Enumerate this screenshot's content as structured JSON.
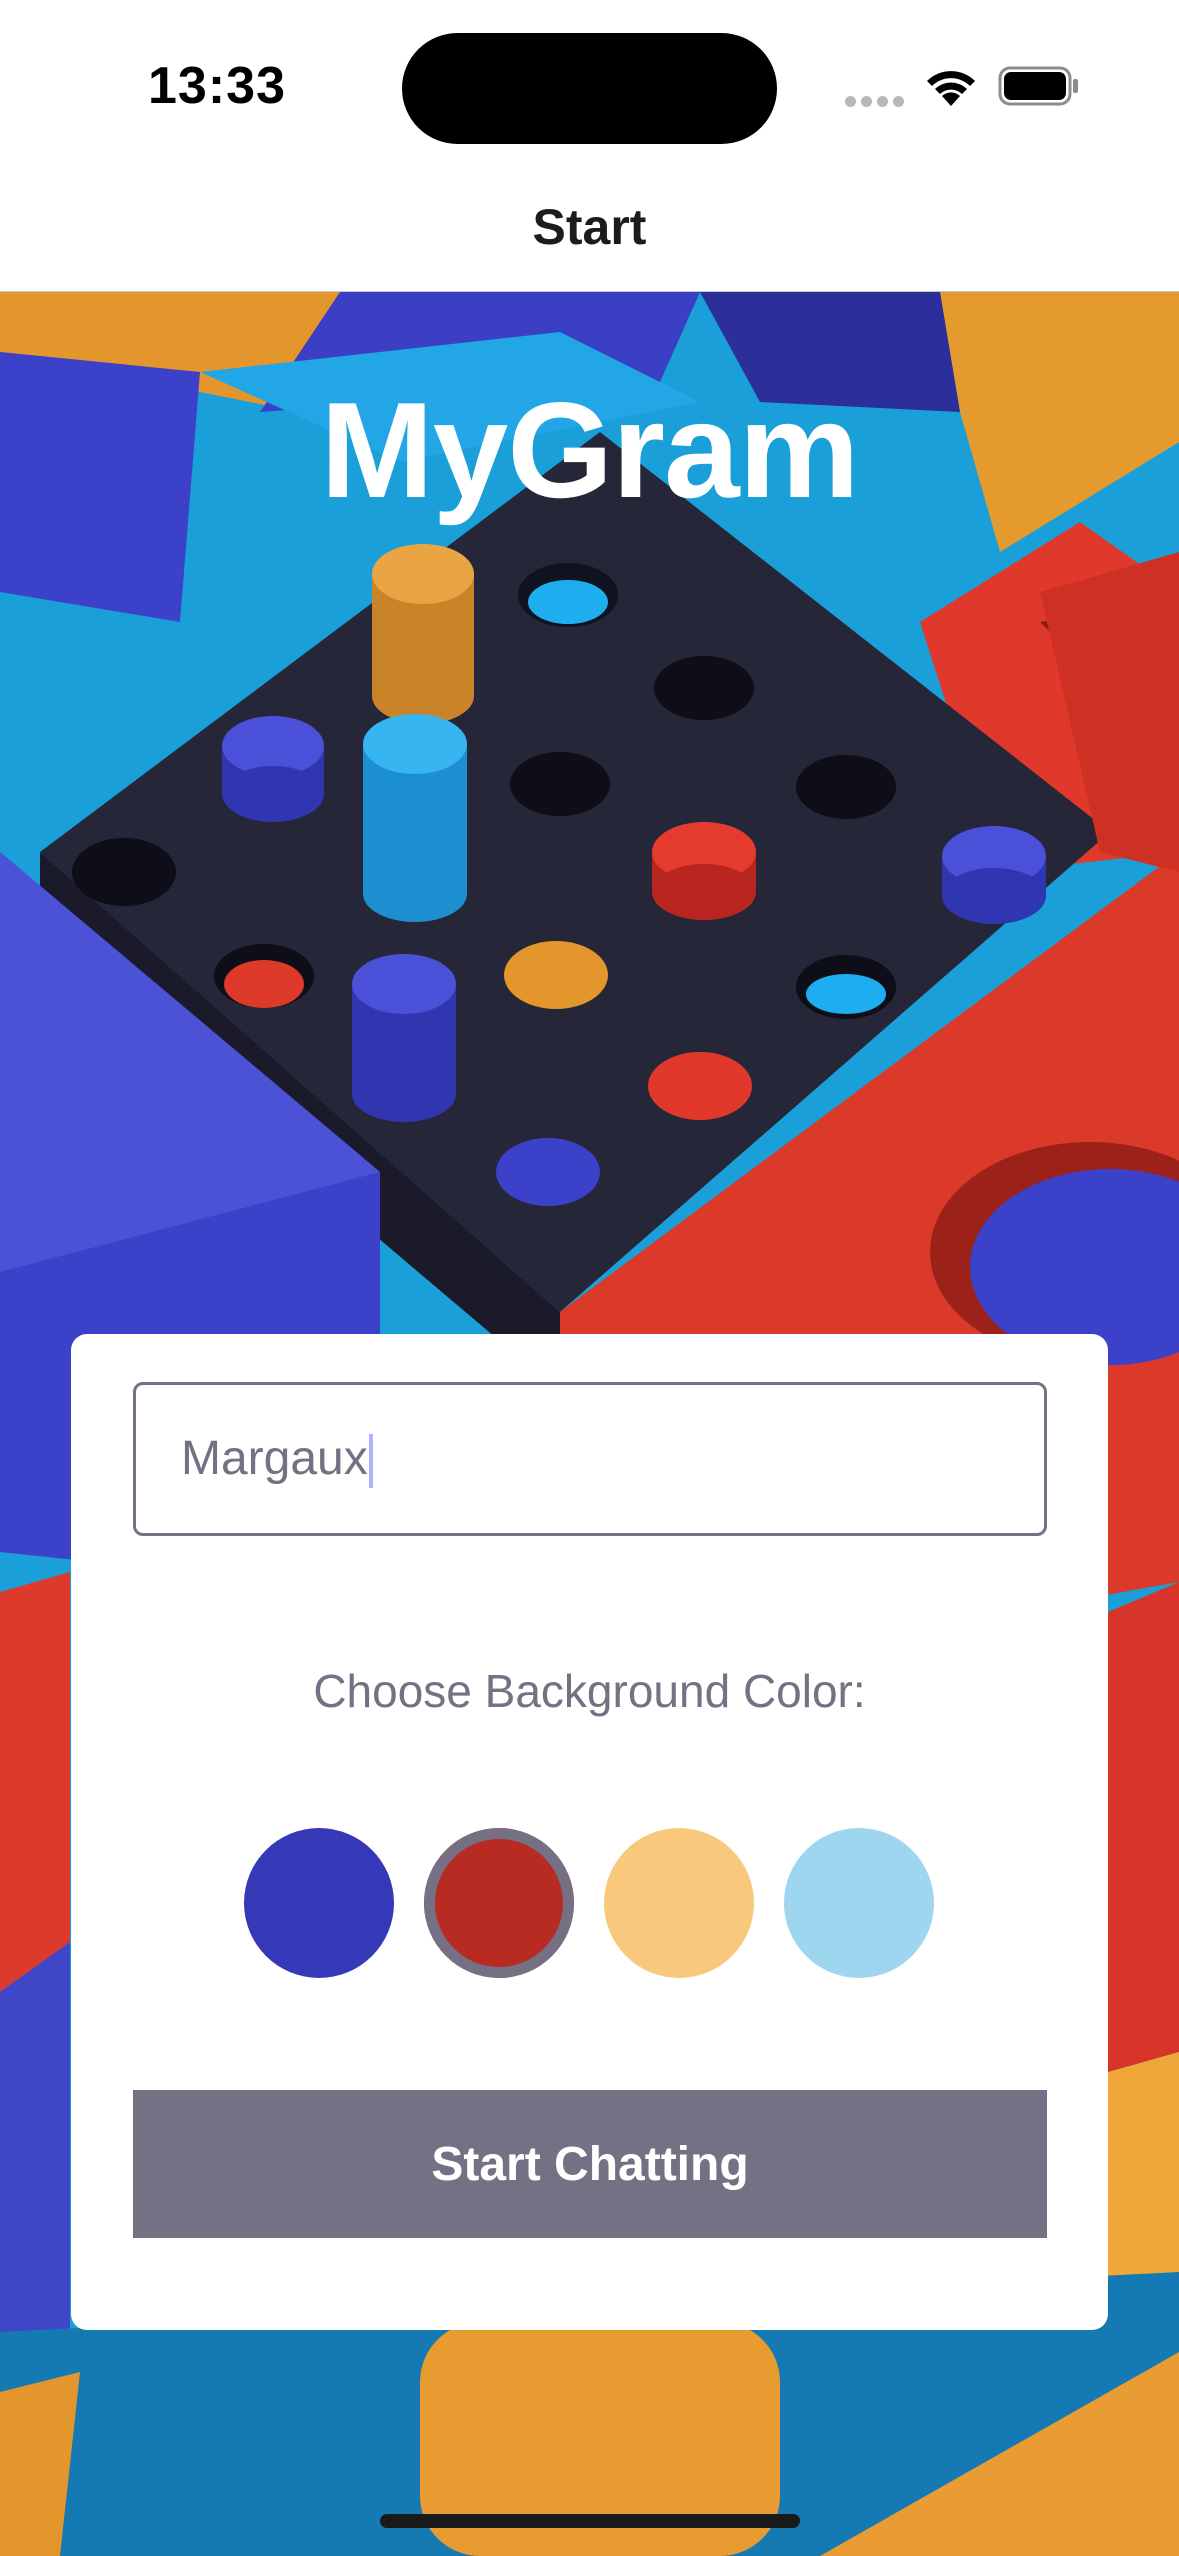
{
  "status_bar": {
    "time": "13:33",
    "icons": [
      "cellular-signal-icon",
      "wifi-icon",
      "battery-icon"
    ]
  },
  "nav": {
    "title": "Start"
  },
  "app": {
    "title": "MyGram"
  },
  "form": {
    "name_value": "Margaux",
    "color_label": "Choose Background Color:",
    "colors": [
      {
        "name": "color-option-1",
        "hex": "#3539b8",
        "selected": false
      },
      {
        "name": "color-option-2",
        "hex": "#b72b22",
        "selected": true
      },
      {
        "name": "color-option-3",
        "hex": "#f8c97c",
        "selected": false
      },
      {
        "name": "color-option-4",
        "hex": "#9fd6ef",
        "selected": false
      }
    ],
    "start_button_label": "Start Chatting"
  },
  "theme": {
    "accent": "#757083",
    "card_background": "#ffffff",
    "title_color": "#ffffff"
  }
}
